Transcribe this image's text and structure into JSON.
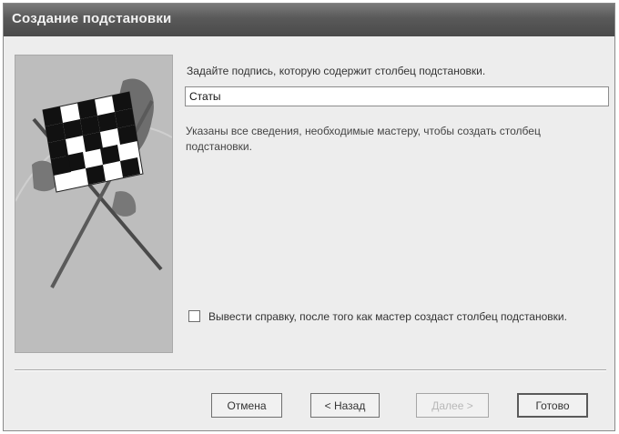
{
  "window": {
    "title": "Создание подстановки"
  },
  "wizard": {
    "prompt": "Задайте подпись, которую содержит столбец подстановки.",
    "caption_value": "Статы",
    "info": "Указаны все сведения, необходимые мастеру, чтобы создать столбец подстановки.",
    "help_checkbox": {
      "label": "Вывести справку, после того как мастер создаст столбец подстановки.",
      "checked": false
    }
  },
  "buttons": {
    "cancel": "Отмена",
    "back": "< Назад",
    "next": "Далее >",
    "finish": "Готово"
  },
  "icons": {
    "side_image": "checkered-flag-illustration"
  }
}
